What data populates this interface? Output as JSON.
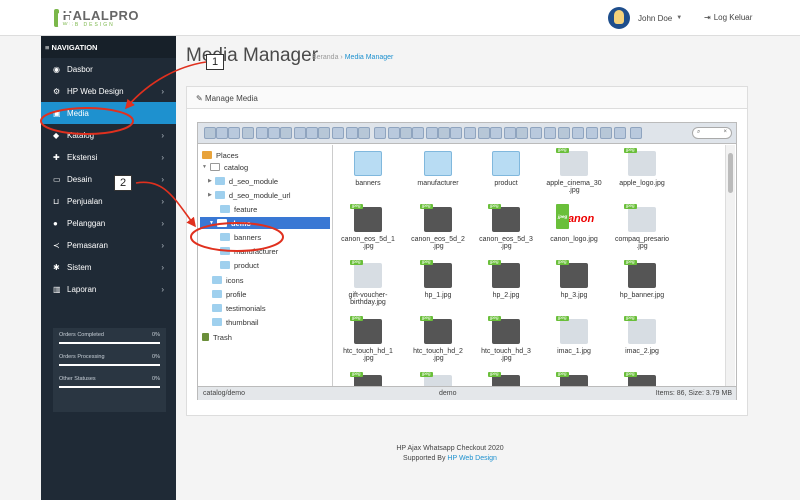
{
  "header": {
    "logo_main": "HALALPRO",
    "logo_sub": "WEB DESIGN",
    "user_name": "John Doe",
    "logout_label": "Log Keluar"
  },
  "sidebar": {
    "title": "NAVIGATION",
    "items": [
      {
        "label": "Dasbor",
        "icon": "dashboard-icon",
        "chevron": false
      },
      {
        "label": "HP Web Design",
        "icon": "cogs-icon",
        "chevron": true
      },
      {
        "label": "Media",
        "icon": "image-icon",
        "chevron": false,
        "active": true
      },
      {
        "label": "Katalog",
        "icon": "tag-icon",
        "chevron": true
      },
      {
        "label": "Ekstensi",
        "icon": "puzzle-icon",
        "chevron": true
      },
      {
        "label": "Desain",
        "icon": "monitor-icon",
        "chevron": true
      },
      {
        "label": "Penjualan",
        "icon": "cart-icon",
        "chevron": true
      },
      {
        "label": "Pelanggan",
        "icon": "user-icon",
        "chevron": true
      },
      {
        "label": "Pemasaran",
        "icon": "share-icon",
        "chevron": true
      },
      {
        "label": "Sistem",
        "icon": "gear-icon",
        "chevron": true
      },
      {
        "label": "Laporan",
        "icon": "bar-chart-icon",
        "chevron": true
      }
    ],
    "stats": [
      {
        "label": "Orders Completed",
        "value": "0%"
      },
      {
        "label": "Orders Processing",
        "value": "0%"
      },
      {
        "label": "Other Statuses",
        "value": "0%"
      }
    ]
  },
  "page": {
    "title": "Media Manager",
    "breadcrumb_home": "Beranda",
    "breadcrumb_sep": "›",
    "breadcrumb_current": "Media Manager",
    "panel_title": "Manage Media"
  },
  "media_manager": {
    "search_placeholder": "⌕",
    "search_clear": "×",
    "tree": [
      {
        "label": "Places",
        "type": "places"
      },
      {
        "label": "catalog",
        "type": "root"
      },
      {
        "label": "d_seo_module",
        "type": "folder"
      },
      {
        "label": "d_seo_module_url",
        "type": "folder"
      },
      {
        "label": "feature",
        "type": "folder"
      },
      {
        "label": "demo",
        "type": "selected"
      },
      {
        "label": "banners",
        "type": "folder"
      },
      {
        "label": "manufacturer",
        "type": "folder"
      },
      {
        "label": "product",
        "type": "folder"
      },
      {
        "label": "icons",
        "type": "folder"
      },
      {
        "label": "profile",
        "type": "folder"
      },
      {
        "label": "testimonials",
        "type": "folder"
      },
      {
        "label": "thumbnail",
        "type": "folder"
      },
      {
        "label": "Trash",
        "type": "trash"
      }
    ],
    "files": [
      {
        "name": "banners",
        "kind": "folder"
      },
      {
        "name": "manufacturer",
        "kind": "folder"
      },
      {
        "name": "product",
        "kind": "folder"
      },
      {
        "name": "apple_cinema_30\n.jpg",
        "kind": "monitor"
      },
      {
        "name": "apple_logo.jpg",
        "kind": "apple"
      },
      {
        "name": "canon_eos_5d_1\n.jpg",
        "kind": "camera"
      },
      {
        "name": "canon_eos_5d_2\n.jpg",
        "kind": "camera"
      },
      {
        "name": "canon_eos_5d_3\n.jpg",
        "kind": "camera"
      },
      {
        "name": "canon_logo.jpg",
        "kind": "canon"
      },
      {
        "name": "compaq_presario\n.jpg",
        "kind": "monitor"
      },
      {
        "name": "gift-voucher-\nbirthday.jpg",
        "kind": "card"
      },
      {
        "name": "hp_1.jpg",
        "kind": "laptop"
      },
      {
        "name": "hp_2.jpg",
        "kind": "laptop"
      },
      {
        "name": "hp_3.jpg",
        "kind": "laptop"
      },
      {
        "name": "hp_banner.jpg",
        "kind": "laptop"
      },
      {
        "name": "htc_touch_hd_1\n.jpg",
        "kind": "phone"
      },
      {
        "name": "htc_touch_hd_2\n.jpg",
        "kind": "phone"
      },
      {
        "name": "htc_touch_hd_3\n.jpg",
        "kind": "phone"
      },
      {
        "name": "imac_1.jpg",
        "kind": "monitor"
      },
      {
        "name": "imac_2.jpg",
        "kind": "monitor"
      },
      {
        "name": "",
        "kind": "phone"
      },
      {
        "name": "",
        "kind": "card"
      },
      {
        "name": "",
        "kind": "phone"
      },
      {
        "name": "",
        "kind": "laptop"
      },
      {
        "name": "",
        "kind": "laptop"
      }
    ],
    "badge_label": "jpeg",
    "canon_text": "Canon",
    "status_path": "catalog/demo",
    "status_folder": "demo",
    "status_info": "Items: 86, Size: 3.79 MB"
  },
  "footer": {
    "line1": "HP Ajax Whatsapp Checkout 2020",
    "line2_prefix": "Supported By ",
    "line2_link": "HP Web Design"
  },
  "annotations": {
    "callout_1": "1",
    "callout_2": "2"
  },
  "colors": {
    "accent": "#1e91cf",
    "sidebar": "#1f2a36",
    "annotation": "#e0301e"
  }
}
